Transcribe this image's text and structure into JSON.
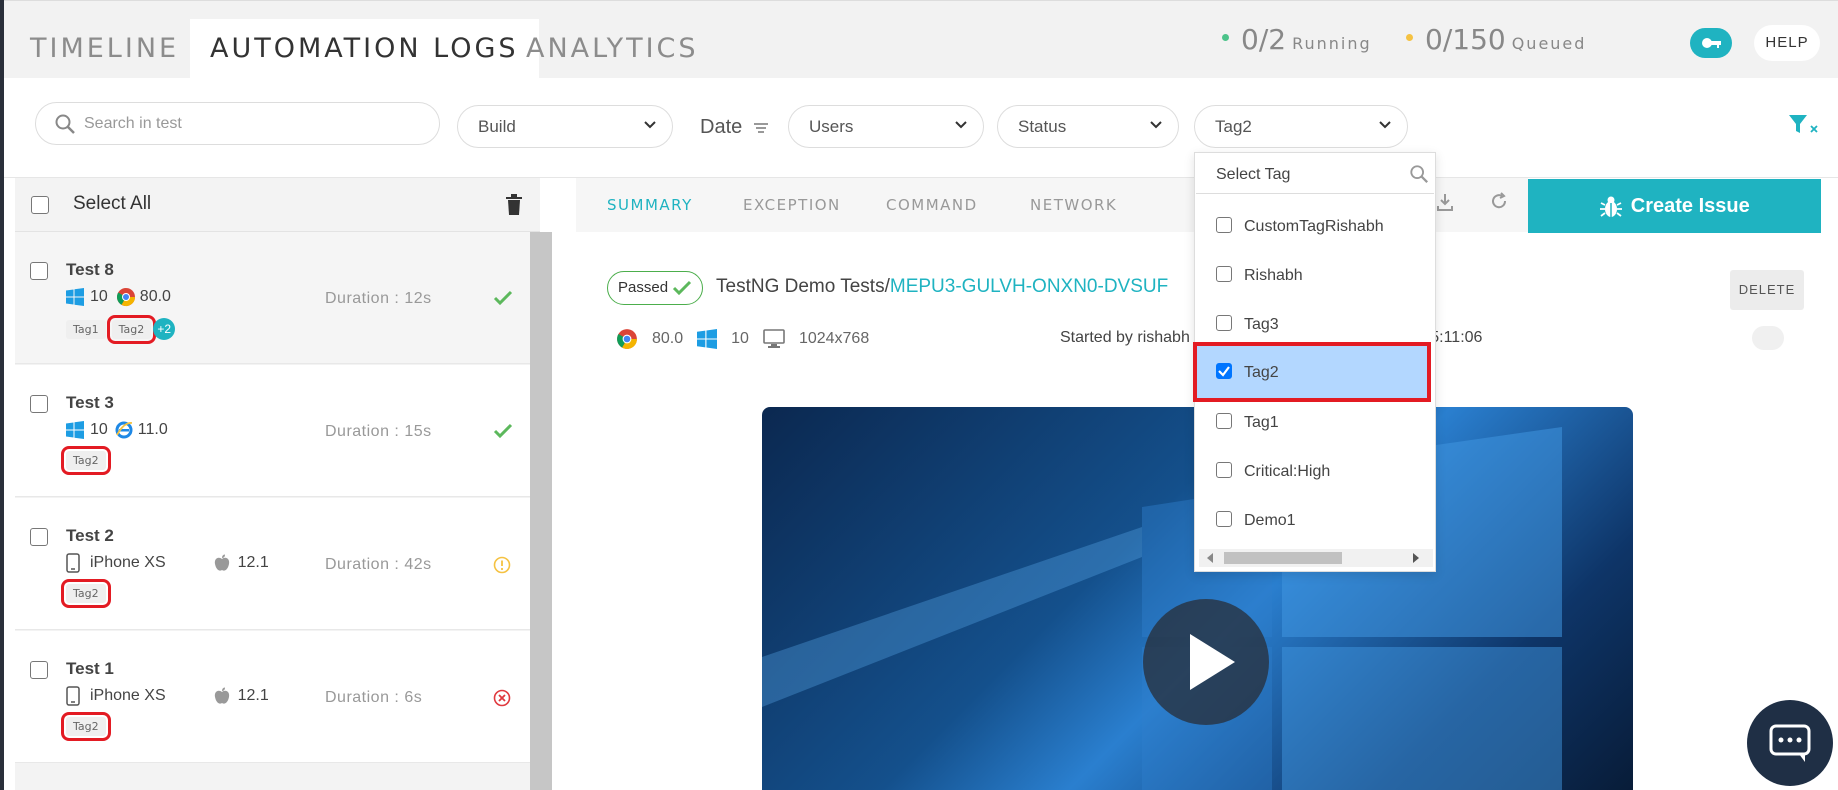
{
  "nav": {
    "tabs": [
      "TIMELINE",
      "AUTOMATION LOGS",
      "ANALYTICS"
    ],
    "running": {
      "count": "0/2",
      "label": "Running",
      "color": "#4cc38a"
    },
    "queued": {
      "count": "0/150",
      "label": "Queued",
      "color": "#f5c242"
    },
    "help_label": "HELP"
  },
  "filters": {
    "search_placeholder": "Search in test",
    "build": "Build",
    "date": "Date",
    "users": "Users",
    "status": "Status",
    "tag": "Tag2"
  },
  "left_panel": {
    "select_all": "Select All",
    "tests": [
      {
        "name": "Test 8",
        "os_version": "10",
        "browser_version": "80.0",
        "duration": "Duration : 12s",
        "tags": [
          "Tag1",
          "Tag2"
        ],
        "more_tags": "+2",
        "status": "passed"
      },
      {
        "name": "Test 3",
        "os_version": "10",
        "browser_version": "11.0",
        "duration": "Duration : 15s",
        "tags": [
          "Tag2"
        ],
        "status": "passed"
      },
      {
        "name": "Test 2",
        "device": "iPhone XS",
        "os_version": "12.1",
        "duration": "Duration : 42s",
        "tags": [
          "Tag2"
        ],
        "status": "warning"
      },
      {
        "name": "Test 1",
        "device": "iPhone XS",
        "os_version": "12.1",
        "duration": "Duration : 6s",
        "tags": [
          "Tag2"
        ],
        "status": "failed"
      }
    ]
  },
  "detail": {
    "subtabs": [
      "SUMMARY",
      "EXCEPTION",
      "COMMAND",
      "NETWORK"
    ],
    "create_issue": "Create Issue",
    "passed_label": "Passed",
    "title_prefix": "TestNG Demo Tests/",
    "test_id": "MEPU3-GULVH-ONXN0-DVSUF",
    "delete_label": "DELETE",
    "browser_version": "80.0",
    "os_version": "10",
    "resolution": "1024x768",
    "started_by": "Started by rishabh",
    "started_time": "p 15:11:06"
  },
  "tag_dropdown": {
    "placeholder": "Select Tag",
    "options": [
      {
        "label": "CustomTagRishabh",
        "checked": false
      },
      {
        "label": "Rishabh",
        "checked": false
      },
      {
        "label": "Tag3",
        "checked": false
      },
      {
        "label": "Tag2",
        "checked": true
      },
      {
        "label": "Tag1",
        "checked": false
      },
      {
        "label": "Critical:High",
        "checked": false
      },
      {
        "label": "Demo1",
        "checked": false
      }
    ]
  },
  "colors": {
    "accent": "#1fb3c1",
    "highlight": "#e31b23",
    "success": "#5cb85c",
    "warning": "#f5c242",
    "error": "#e0393e"
  }
}
